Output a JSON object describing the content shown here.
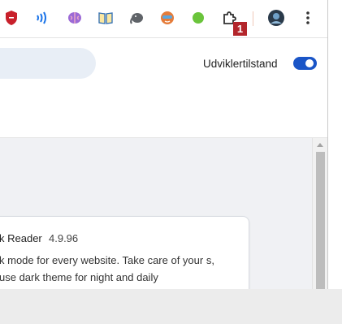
{
  "toolbar": {
    "extensions": [
      {
        "icon": "shield-icon",
        "color": "#c8202b"
      },
      {
        "icon": "wave-icon",
        "color": "#1a73e8"
      },
      {
        "icon": "brain-icon",
        "color": "#9c6ad6"
      },
      {
        "icon": "book-icon",
        "color": "#2e6db4"
      },
      {
        "icon": "elephant-icon",
        "color": "#5f6368"
      },
      {
        "icon": "face-icon",
        "color": "#e57c3a"
      },
      {
        "icon": "green-dot-icon",
        "color": "#6ac43b"
      },
      {
        "icon": "puzzle-icon",
        "color": "#333333"
      }
    ],
    "badge": "1",
    "profile_icon": "profile-avatar-icon",
    "menu_icon": "more-vert-icon"
  },
  "header": {
    "dev_mode_label": "Udviklertilstand",
    "dev_mode_on": true,
    "accent": "#1a55c7"
  },
  "card": {
    "title": "k Reader",
    "version": "4.9.96",
    "description": "k mode for every website. Take care of your s, use dark theme for night and daily"
  }
}
